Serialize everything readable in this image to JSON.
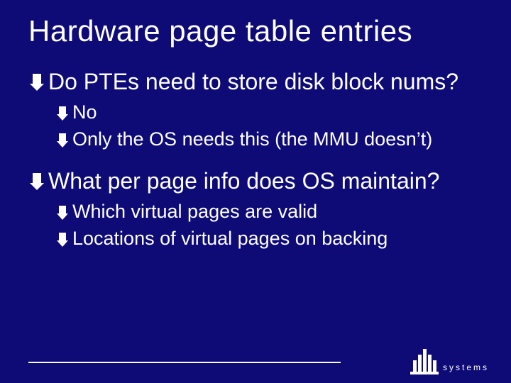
{
  "title": "Hardware page table entries",
  "bullets": {
    "b1": "Do PTEs need to store disk block nums?",
    "b1a": "No",
    "b1b": "Only the OS needs this (the MMU doesn’t)",
    "b2": "What per page info does OS maintain?",
    "b2a": "Which virtual pages are valid",
    "b2b": "Locations of virtual pages on backing"
  }
}
